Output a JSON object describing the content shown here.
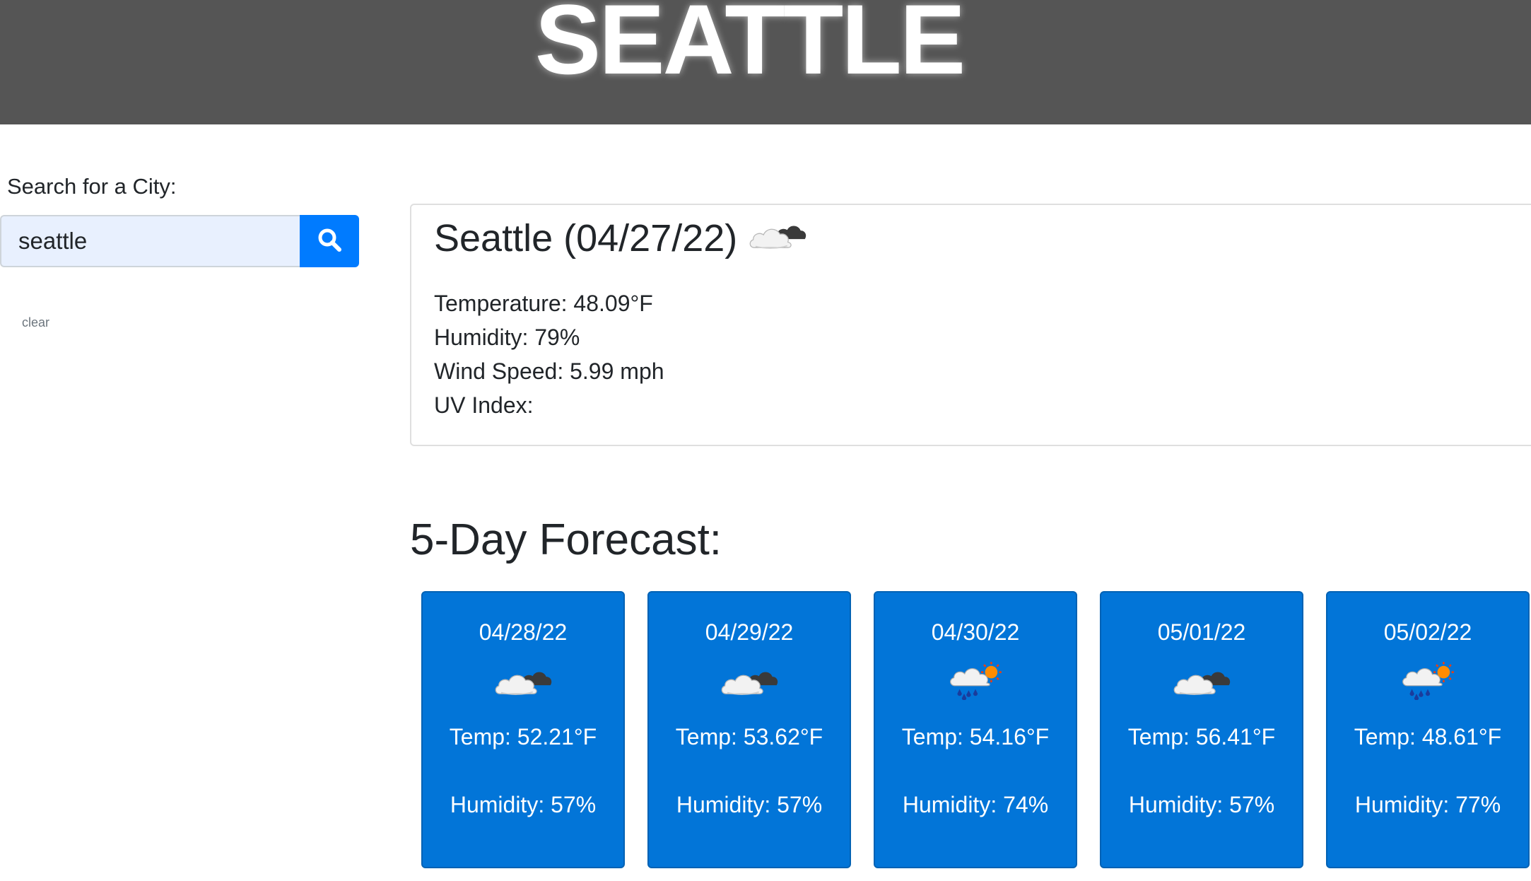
{
  "header": {
    "title": "SEATTLE"
  },
  "search": {
    "label": "Search for a City:",
    "value": "seattle",
    "icon": "search-icon",
    "clear_label": "clear"
  },
  "current": {
    "title": "Seattle (04/27/22)",
    "icon": "broken-clouds-icon",
    "temperature": "Temperature: 48.09°F",
    "humidity": "Humidity: 79%",
    "wind": "Wind Speed: 5.99 mph",
    "uv": "UV Index:"
  },
  "forecast": {
    "heading": "5-Day Forecast:",
    "days": [
      {
        "date": "04/28/22",
        "icon": "broken-clouds-icon",
        "temp": "Temp: 52.21°F",
        "humidity": "Humidity: 57%"
      },
      {
        "date": "04/29/22",
        "icon": "broken-clouds-icon",
        "temp": "Temp: 53.62°F",
        "humidity": "Humidity: 57%"
      },
      {
        "date": "04/30/22",
        "icon": "rain-icon",
        "temp": "Temp: 54.16°F",
        "humidity": "Humidity: 74%"
      },
      {
        "date": "05/01/22",
        "icon": "broken-clouds-icon",
        "temp": "Temp: 56.41°F",
        "humidity": "Humidity: 57%"
      },
      {
        "date": "05/02/22",
        "icon": "rain-icon",
        "temp": "Temp: 48.61°F",
        "humidity": "Humidity: 77%"
      }
    ]
  },
  "colors": {
    "header_bg": "#555555",
    "accent": "#007bff",
    "card_bg": "#0275d8"
  }
}
